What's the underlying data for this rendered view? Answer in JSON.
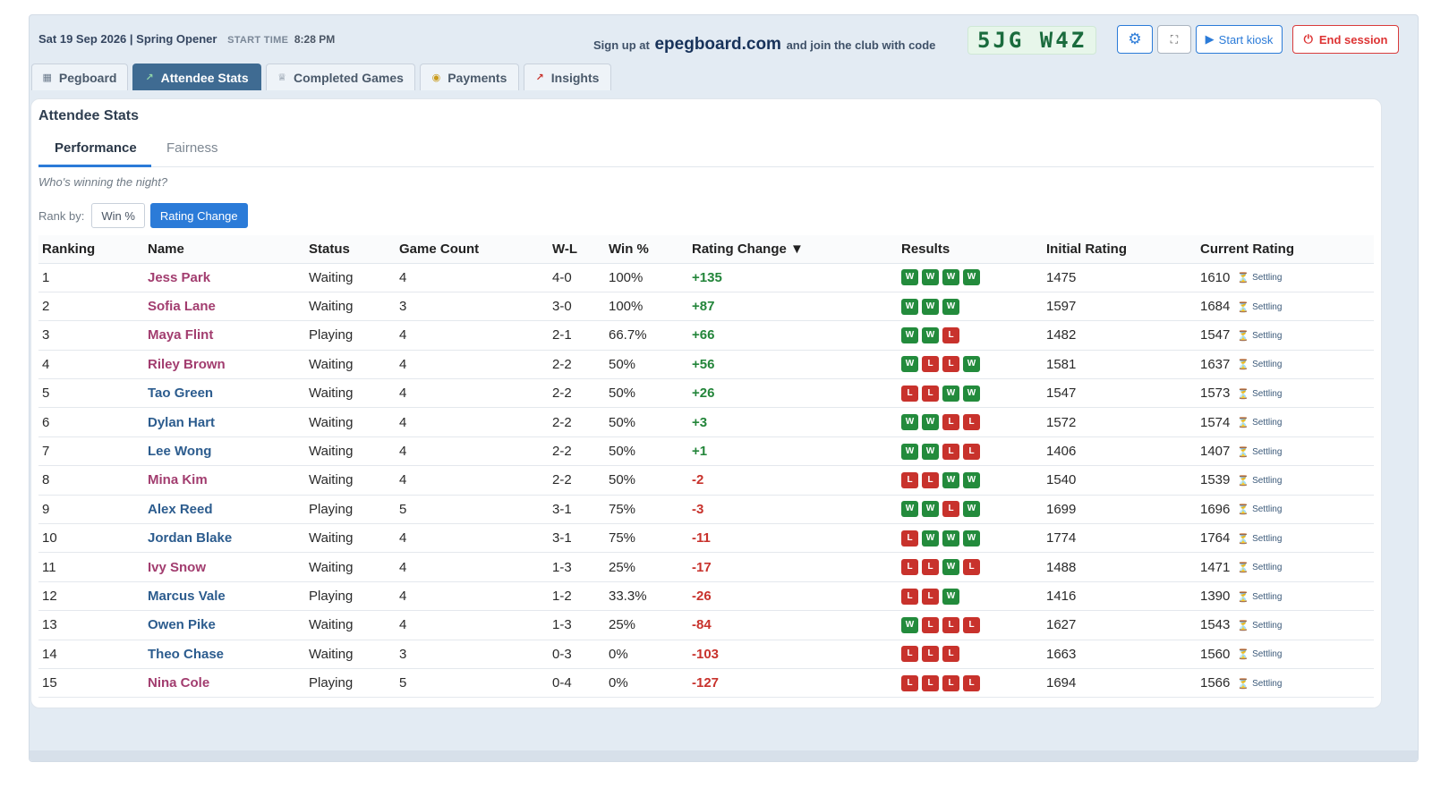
{
  "session": {
    "date_event": "Sat 19 Sep 2026 | Spring Opener",
    "start_time_label": "START TIME",
    "start_time": "8:28 PM"
  },
  "signup": {
    "prefix": "Sign up at",
    "site": "epegboard.com",
    "suffix": "and join the club with code",
    "code": "5JG W4Z"
  },
  "toolbar": {
    "settings_icon": "gear-icon",
    "fullscreen_icon": "fullscreen-icon",
    "kiosk_label": "Start kiosk",
    "end_label": "End session"
  },
  "tabs": [
    {
      "label": "Pegboard",
      "icon": "grid-icon"
    },
    {
      "label": "Attendee Stats",
      "icon": "chart-icon",
      "active": true
    },
    {
      "label": "Completed Games",
      "icon": "trophy-icon"
    },
    {
      "label": "Payments",
      "icon": "coin-icon"
    },
    {
      "label": "Insights",
      "icon": "trend-icon"
    }
  ],
  "panel": {
    "title": "Attendee Stats",
    "subtabs": [
      {
        "label": "Performance",
        "active": true
      },
      {
        "label": "Fairness"
      }
    ],
    "tagline": "Who's winning the night?",
    "rank_by_label": "Rank by:",
    "rank_options": [
      "Win %",
      "Rating Change"
    ],
    "rank_selected": "Rating Change"
  },
  "table": {
    "headers": [
      "Ranking",
      "Name",
      "Status",
      "Game Count",
      "W-L",
      "Win %",
      "Rating Change ▼",
      "Results",
      "Initial Rating",
      "Current Rating"
    ],
    "settling_label": "Settling",
    "rows": [
      {
        "rank": "1",
        "name": "Jess Park",
        "color": "pink",
        "status": "Waiting",
        "games": "4",
        "wl": "4-0",
        "pct": "100%",
        "delta": "+135",
        "results": [
          "W",
          "W",
          "W",
          "W"
        ],
        "initial": "1475",
        "current": "1610"
      },
      {
        "rank": "2",
        "name": "Sofia Lane",
        "color": "pink",
        "status": "Waiting",
        "games": "3",
        "wl": "3-0",
        "pct": "100%",
        "delta": "+87",
        "results": [
          "W",
          "W",
          "W"
        ],
        "initial": "1597",
        "current": "1684"
      },
      {
        "rank": "3",
        "name": "Maya Flint",
        "color": "pink",
        "status": "Playing",
        "games": "4",
        "wl": "2-1",
        "pct": "66.7%",
        "delta": "+66",
        "results": [
          "W",
          "W",
          "L"
        ],
        "initial": "1482",
        "current": "1547"
      },
      {
        "rank": "4",
        "name": "Riley Brown",
        "color": "pink",
        "status": "Waiting",
        "games": "4",
        "wl": "2-2",
        "pct": "50%",
        "delta": "+56",
        "results": [
          "W",
          "L",
          "L",
          "W"
        ],
        "initial": "1581",
        "current": "1637"
      },
      {
        "rank": "5",
        "name": "Tao Green",
        "color": "blue",
        "status": "Waiting",
        "games": "4",
        "wl": "2-2",
        "pct": "50%",
        "delta": "+26",
        "results": [
          "L",
          "L",
          "W",
          "W"
        ],
        "initial": "1547",
        "current": "1573"
      },
      {
        "rank": "6",
        "name": "Dylan Hart",
        "color": "blue",
        "status": "Waiting",
        "games": "4",
        "wl": "2-2",
        "pct": "50%",
        "delta": "+3",
        "results": [
          "W",
          "W",
          "L",
          "L"
        ],
        "initial": "1572",
        "current": "1574"
      },
      {
        "rank": "7",
        "name": "Lee Wong",
        "color": "blue",
        "status": "Waiting",
        "games": "4",
        "wl": "2-2",
        "pct": "50%",
        "delta": "+1",
        "results": [
          "W",
          "W",
          "L",
          "L"
        ],
        "initial": "1406",
        "current": "1407"
      },
      {
        "rank": "8",
        "name": "Mina Kim",
        "color": "pink",
        "status": "Waiting",
        "games": "4",
        "wl": "2-2",
        "pct": "50%",
        "delta": "-2",
        "results": [
          "L",
          "L",
          "W",
          "W"
        ],
        "initial": "1540",
        "current": "1539"
      },
      {
        "rank": "9",
        "name": "Alex Reed",
        "color": "blue",
        "status": "Playing",
        "games": "5",
        "wl": "3-1",
        "pct": "75%",
        "delta": "-3",
        "results": [
          "W",
          "W",
          "L",
          "W"
        ],
        "initial": "1699",
        "current": "1696"
      },
      {
        "rank": "10",
        "name": "Jordan Blake",
        "color": "blue",
        "status": "Waiting",
        "games": "4",
        "wl": "3-1",
        "pct": "75%",
        "delta": "-11",
        "results": [
          "L",
          "W",
          "W",
          "W"
        ],
        "initial": "1774",
        "current": "1764"
      },
      {
        "rank": "11",
        "name": "Ivy Snow",
        "color": "pink",
        "status": "Waiting",
        "games": "4",
        "wl": "1-3",
        "pct": "25%",
        "delta": "-17",
        "results": [
          "L",
          "L",
          "W",
          "L"
        ],
        "initial": "1488",
        "current": "1471"
      },
      {
        "rank": "12",
        "name": "Marcus Vale",
        "color": "blue",
        "status": "Playing",
        "games": "4",
        "wl": "1-2",
        "pct": "33.3%",
        "delta": "-26",
        "results": [
          "L",
          "L",
          "W"
        ],
        "initial": "1416",
        "current": "1390"
      },
      {
        "rank": "13",
        "name": "Owen Pike",
        "color": "blue",
        "status": "Waiting",
        "games": "4",
        "wl": "1-3",
        "pct": "25%",
        "delta": "-84",
        "results": [
          "W",
          "L",
          "L",
          "L"
        ],
        "initial": "1627",
        "current": "1543"
      },
      {
        "rank": "14",
        "name": "Theo Chase",
        "color": "blue",
        "status": "Waiting",
        "games": "3",
        "wl": "0-3",
        "pct": "0%",
        "delta": "-103",
        "results": [
          "L",
          "L",
          "L"
        ],
        "initial": "1663",
        "current": "1560"
      },
      {
        "rank": "15",
        "name": "Nina Cole",
        "color": "pink",
        "status": "Playing",
        "games": "5",
        "wl": "0-4",
        "pct": "0%",
        "delta": "-127",
        "results": [
          "L",
          "L",
          "L",
          "L"
        ],
        "initial": "1694",
        "current": "1566"
      }
    ]
  },
  "colors": {
    "accent": "#2b7bd8",
    "active_tab": "#3f6b92",
    "win": "#238b3c",
    "loss": "#c8322c",
    "name_pink": "#a23d6f",
    "name_blue": "#2c5c8e"
  }
}
